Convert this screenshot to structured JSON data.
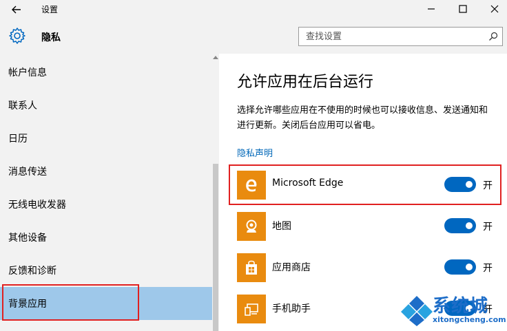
{
  "window": {
    "title": "设置"
  },
  "header": {
    "section_title": "隐私",
    "search_placeholder": "查找设置"
  },
  "sidebar": {
    "items": [
      {
        "label": "帐户信息"
      },
      {
        "label": "联系人"
      },
      {
        "label": "日历"
      },
      {
        "label": "消息传送"
      },
      {
        "label": "无线电收发器"
      },
      {
        "label": "其他设备"
      },
      {
        "label": "反馈和诊断"
      },
      {
        "label": "背景应用",
        "selected": true
      }
    ]
  },
  "main": {
    "title": "允许应用在后台运行",
    "description": "选择允许哪些应用在不使用的时候也可以接收信息、发送通知和进行更新。关闭后台应用可以省电。",
    "privacy_link": "隐私声明",
    "apps": [
      {
        "name": "Microsoft Edge",
        "icon": "edge-icon",
        "state_label": "开",
        "on": true
      },
      {
        "name": "地图",
        "icon": "maps-icon",
        "state_label": "开",
        "on": true
      },
      {
        "name": "应用商店",
        "icon": "store-icon",
        "state_label": "开",
        "on": true
      },
      {
        "name": "手机助手",
        "icon": "phone-companion-icon",
        "state_label": "开",
        "on": true
      }
    ]
  },
  "watermark": {
    "text_cn": "系统城",
    "text_en": "xitongcheng.com"
  },
  "colors": {
    "accent": "#0067c0",
    "selected_bg": "#9ec8ea",
    "app_tile": "#e98b0f",
    "highlight": "#e02020"
  }
}
